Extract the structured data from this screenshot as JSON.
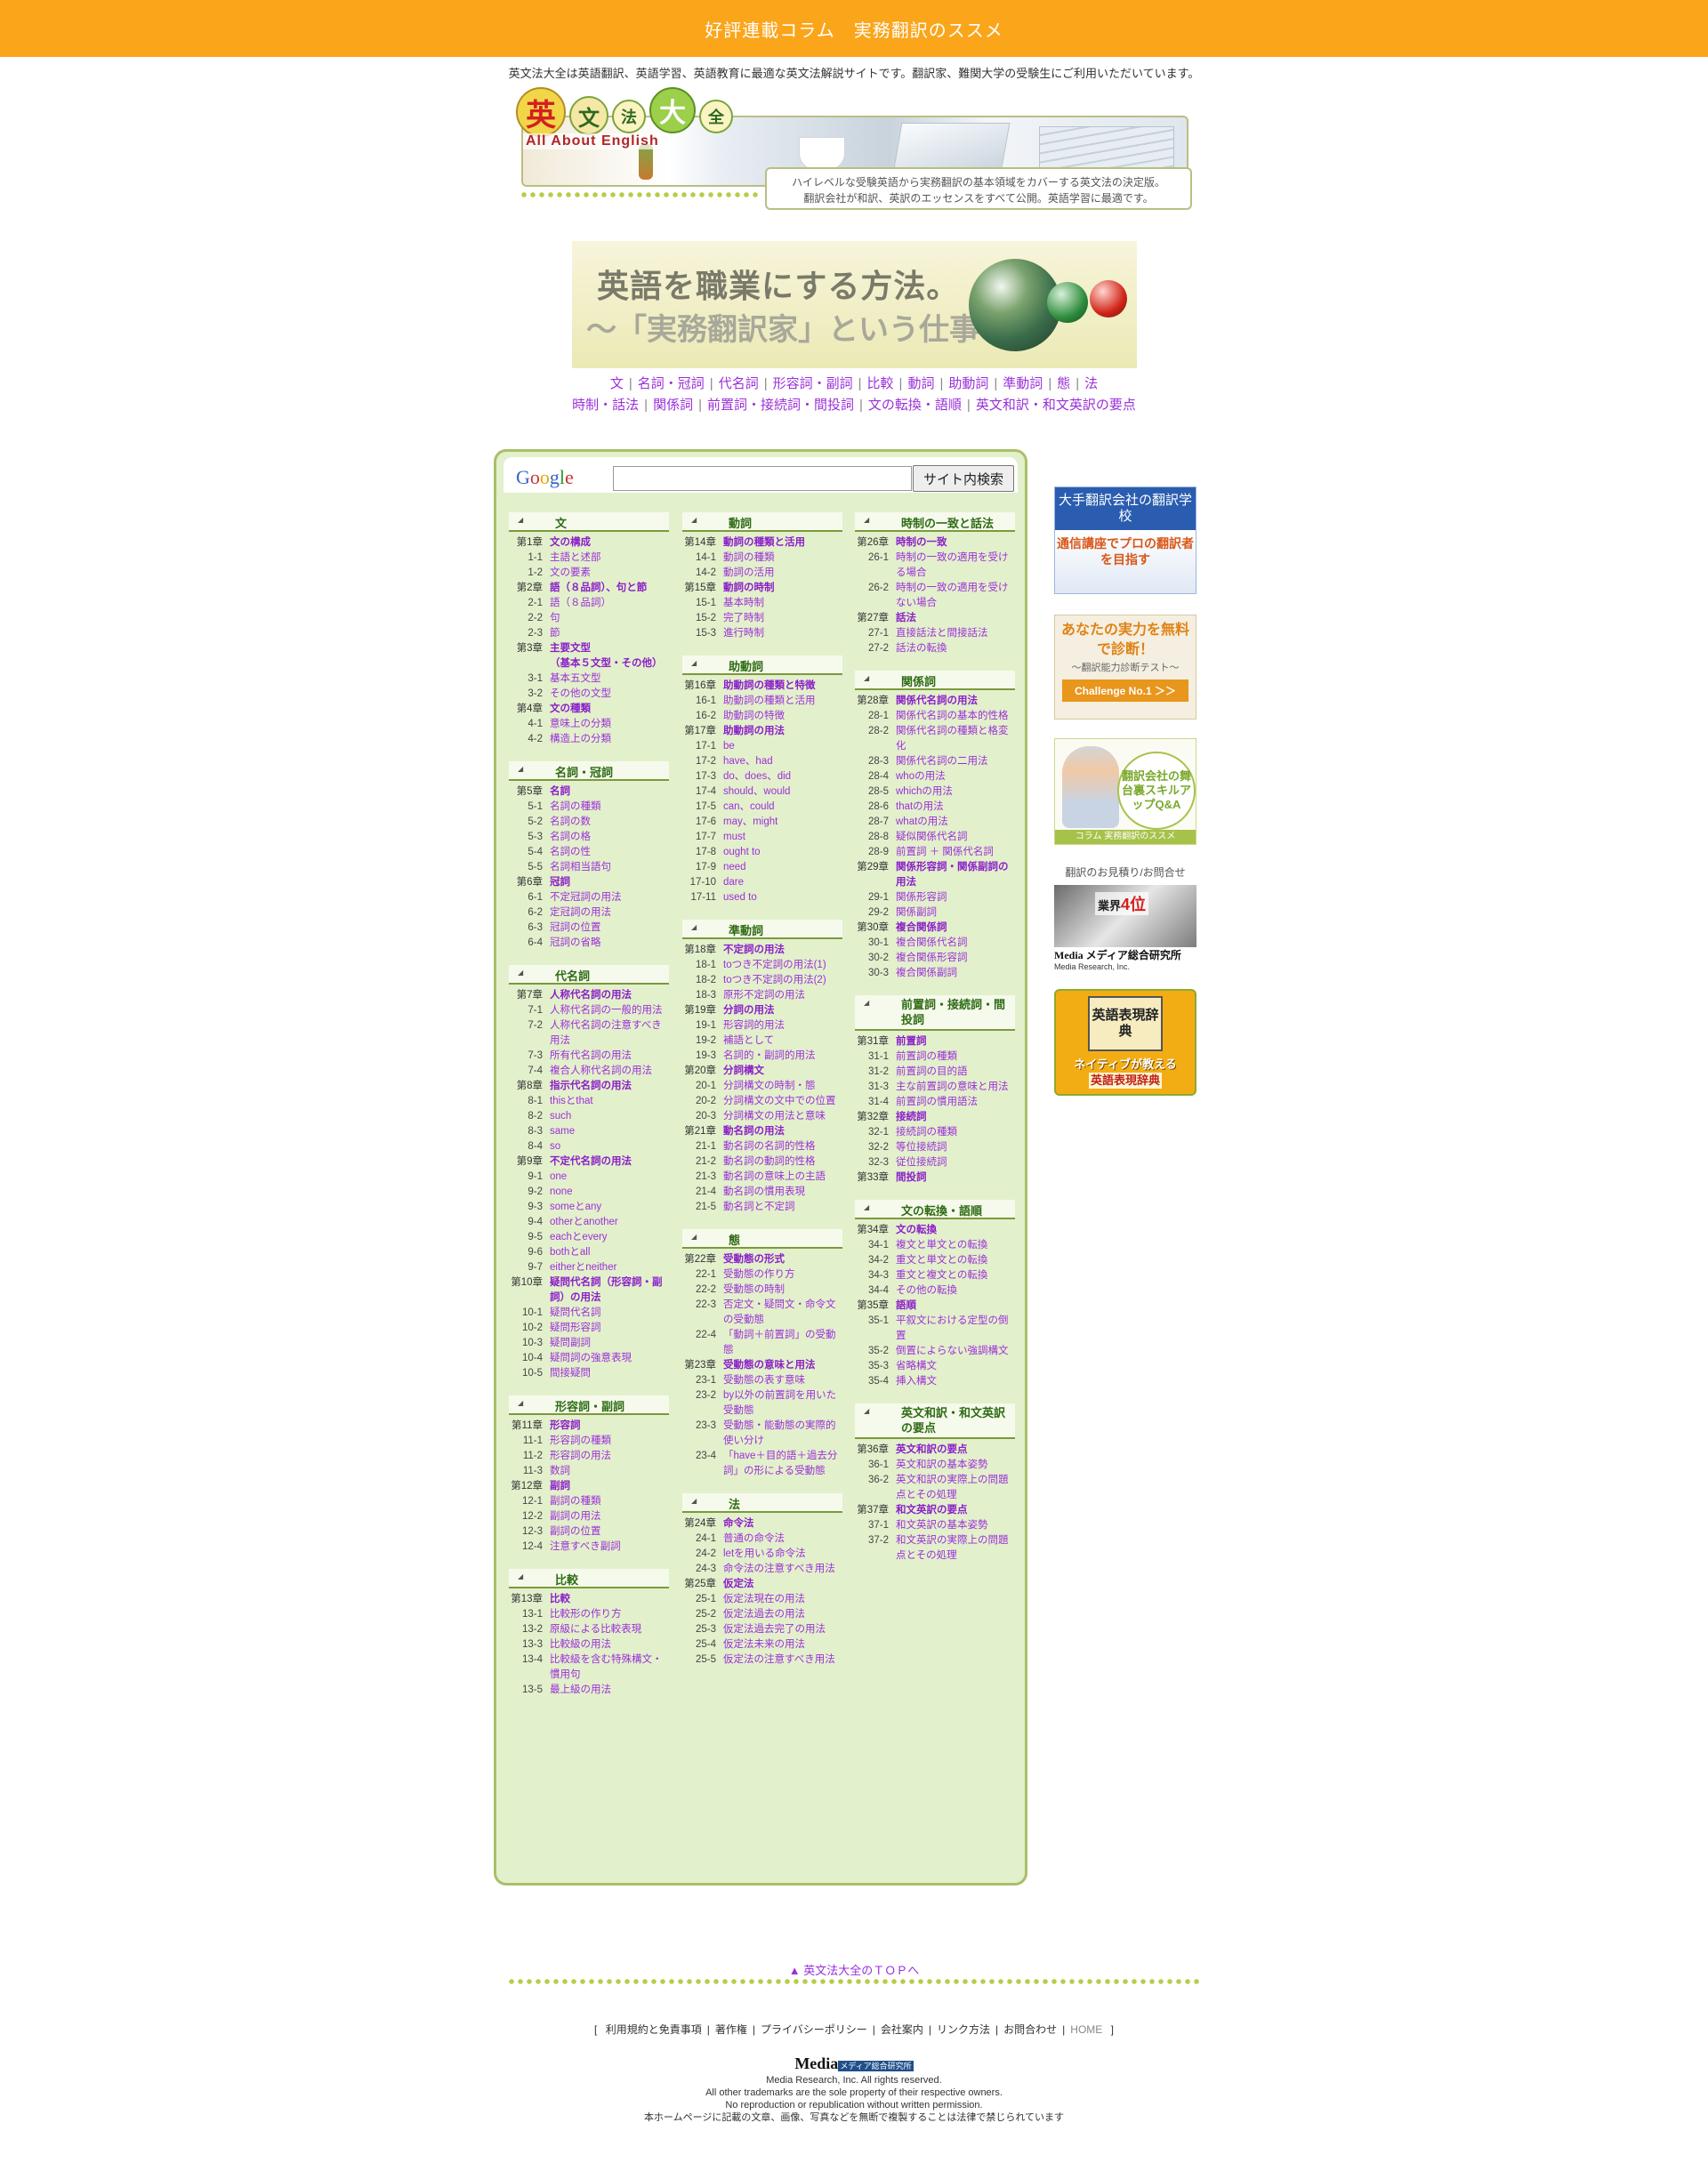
{
  "topbar": {
    "title": "好評連載コラム　実務翻訳のススメ"
  },
  "intro": "英文法大全は英語翻訳、英語学習、英語教育に最適な英文法解説サイトです。翻訳家、難関大学の受験生にご利用いただいています。",
  "header": {
    "logo_chars": [
      "英",
      "文",
      "法",
      "大",
      "全"
    ],
    "logo_sub": "All About English",
    "tagline_1": "ハイレベルな受験英語から実務翻訳の基本領域をカバーする英文法の決定版。",
    "tagline_2": "翻訳会社が和訳、英訳のエッセンスをすべて公開。英語学習に最適です。"
  },
  "promo": {
    "line1": "英語を職業にする方法。",
    "line2": "〜「実務翻訳家」という仕事〜"
  },
  "nav": {
    "row1": [
      "文",
      "名詞・冠詞",
      "代名詞",
      "形容詞・副詞",
      "比較",
      "動詞",
      "助動詞",
      "準動詞",
      "態",
      "法"
    ],
    "row2": [
      "時制・話法",
      "関係詞",
      "前置詞・接続詞・間投詞",
      "文の転換・語順",
      "英文和訳・和文英訳の要点"
    ]
  },
  "search": {
    "logo": "Google",
    "button": "サイト内検索",
    "value": ""
  },
  "columns": [
    [
      {
        "title": "文",
        "rows": [
          [
            "第1章",
            "文の構成",
            1
          ],
          [
            "1-1",
            "主語と述部",
            0
          ],
          [
            "1-2",
            "文の要素",
            0
          ],
          [
            "第2章",
            "語（８品詞）、句と節",
            1
          ],
          [
            "2-1",
            "語（８品詞）",
            0
          ],
          [
            "2-2",
            "句",
            0
          ],
          [
            "2-3",
            "節",
            0
          ],
          [
            "第3章",
            "主要文型\n（基本５文型・その他）",
            1
          ],
          [
            "3-1",
            "基本五文型",
            0
          ],
          [
            "3-2",
            "その他の文型",
            0
          ],
          [
            "第4章",
            "文の種類",
            1
          ],
          [
            "4-1",
            "意味上の分類",
            0
          ],
          [
            "4-2",
            "構造上の分類",
            0
          ]
        ]
      },
      {
        "title": "名詞・冠詞",
        "rows": [
          [
            "第5章",
            "名詞",
            1
          ],
          [
            "5-1",
            "名詞の種類",
            0
          ],
          [
            "5-2",
            "名詞の数",
            0
          ],
          [
            "5-3",
            "名詞の格",
            0
          ],
          [
            "5-4",
            "名詞の性",
            0
          ],
          [
            "5-5",
            "名詞相当語句",
            0
          ],
          [
            "第6章",
            "冠詞",
            1
          ],
          [
            "6-1",
            "不定冠詞の用法",
            0
          ],
          [
            "6-2",
            "定冠詞の用法",
            0
          ],
          [
            "6-3",
            "冠詞の位置",
            0
          ],
          [
            "6-4",
            "冠詞の省略",
            0
          ]
        ]
      },
      {
        "title": "代名詞",
        "rows": [
          [
            "第7章",
            "人称代名詞の用法",
            1
          ],
          [
            "7-1",
            "人称代名詞の一般的用法",
            0
          ],
          [
            "7-2",
            "人称代名詞の注意すべき用法",
            0
          ],
          [
            "7-3",
            "所有代名詞の用法",
            0
          ],
          [
            "7-4",
            "複合人称代名詞の用法",
            0
          ],
          [
            "第8章",
            "指示代名詞の用法",
            1
          ],
          [
            "8-1",
            "thisとthat",
            0
          ],
          [
            "8-2",
            "such",
            0
          ],
          [
            "8-3",
            "same",
            0
          ],
          [
            "8-4",
            "so",
            0
          ],
          [
            "第9章",
            "不定代名詞の用法",
            1
          ],
          [
            "9-1",
            "one",
            0
          ],
          [
            "9-2",
            "none",
            0
          ],
          [
            "9-3",
            "someとany",
            0
          ],
          [
            "9-4",
            "otherとanother",
            0
          ],
          [
            "9-5",
            "eachとevery",
            0
          ],
          [
            "9-6",
            "bothとall",
            0
          ],
          [
            "9-7",
            "eitherとneither",
            0
          ],
          [
            "第10章",
            "疑問代名詞（形容詞・副詞）の用法",
            1
          ],
          [
            "10-1",
            "疑問代名詞",
            0
          ],
          [
            "10-2",
            "疑問形容詞",
            0
          ],
          [
            "10-3",
            "疑問副詞",
            0
          ],
          [
            "10-4",
            "疑問詞の強意表現",
            0
          ],
          [
            "10-5",
            "間接疑問",
            0
          ]
        ]
      },
      {
        "title": "形容詞・副詞",
        "rows": [
          [
            "第11章",
            "形容詞",
            1
          ],
          [
            "11-1",
            "形容詞の種類",
            0
          ],
          [
            "11-2",
            "形容詞の用法",
            0
          ],
          [
            "11-3",
            "数詞",
            0
          ],
          [
            "第12章",
            "副詞",
            1
          ],
          [
            "12-1",
            "副詞の種類",
            0
          ],
          [
            "12-2",
            "副詞の用法",
            0
          ],
          [
            "12-3",
            "副詞の位置",
            0
          ],
          [
            "12-4",
            "注意すべき副詞",
            0
          ]
        ]
      },
      {
        "title": "比較",
        "rows": [
          [
            "第13章",
            "比較",
            1
          ],
          [
            "13-1",
            "比較形の作り方",
            0
          ],
          [
            "13-2",
            "原級による比較表現",
            0
          ],
          [
            "13-3",
            "比較級の用法",
            0
          ],
          [
            "13-4",
            "比較級を含む特殊構文・慣用句",
            0
          ],
          [
            "13-5",
            "最上級の用法",
            0
          ]
        ]
      }
    ],
    [
      {
        "title": "動詞",
        "rows": [
          [
            "第14章",
            "動詞の種類と活用",
            1
          ],
          [
            "14-1",
            "動詞の種類",
            0
          ],
          [
            "14-2",
            "動詞の活用",
            0
          ],
          [
            "第15章",
            "動詞の時制",
            1
          ],
          [
            "15-1",
            "基本時制",
            0
          ],
          [
            "15-2",
            "完了時制",
            0
          ],
          [
            "15-3",
            "進行時制",
            0
          ]
        ]
      },
      {
        "title": "助動詞",
        "rows": [
          [
            "第16章",
            "助動詞の種類と特徴",
            1
          ],
          [
            "16-1",
            "助動詞の種類と活用",
            0
          ],
          [
            "16-2",
            "助動詞の特徴",
            0
          ],
          [
            "第17章",
            "助動詞の用法",
            1
          ],
          [
            "17-1",
            "be",
            0
          ],
          [
            "17-2",
            "have、had",
            0
          ],
          [
            "17-3",
            "do、does、did",
            0
          ],
          [
            "17-4",
            "should、would",
            0
          ],
          [
            "17-5",
            "can、could",
            0
          ],
          [
            "17-6",
            "may、might",
            0
          ],
          [
            "17-7",
            "must",
            0
          ],
          [
            "17-8",
            "ought to",
            0
          ],
          [
            "17-9",
            "need",
            0
          ],
          [
            "17-10",
            "dare",
            0
          ],
          [
            "17-11",
            "used to",
            0
          ]
        ]
      },
      {
        "title": "準動詞",
        "rows": [
          [
            "第18章",
            "不定詞の用法",
            1
          ],
          [
            "18-1",
            "toつき不定詞の用法(1)",
            0
          ],
          [
            "18-2",
            "toつき不定詞の用法(2)",
            0
          ],
          [
            "18-3",
            "原形不定詞の用法",
            0
          ],
          [
            "第19章",
            "分詞の用法",
            1
          ],
          [
            "19-1",
            "形容詞的用法",
            0
          ],
          [
            "19-2",
            "補語として",
            0
          ],
          [
            "19-3",
            "名詞的・副詞的用法",
            0
          ],
          [
            "第20章",
            "分詞構文",
            1
          ],
          [
            "20-1",
            "分詞構文の時制・態",
            0
          ],
          [
            "20-2",
            "分詞構文の文中での位置",
            0
          ],
          [
            "20-3",
            "分詞構文の用法と意味",
            0
          ],
          [
            "第21章",
            "動名詞の用法",
            1
          ],
          [
            "21-1",
            "動名詞の名詞的性格",
            0
          ],
          [
            "21-2",
            "動名詞の動詞的性格",
            0
          ],
          [
            "21-3",
            "動名詞の意味上の主語",
            0
          ],
          [
            "21-4",
            "動名詞の慣用表現",
            0
          ],
          [
            "21-5",
            "動名詞と不定詞",
            0
          ]
        ]
      },
      {
        "title": "態",
        "rows": [
          [
            "第22章",
            "受動態の形式",
            1
          ],
          [
            "22-1",
            "受動態の作り方",
            0
          ],
          [
            "22-2",
            "受動態の時制",
            0
          ],
          [
            "22-3",
            "否定文・疑問文・命令文の受動態",
            0
          ],
          [
            "22-4",
            "「動詞＋前置詞」の受動態",
            0
          ],
          [
            "第23章",
            "受動態の意味と用法",
            1
          ],
          [
            "23-1",
            "受動態の表す意味",
            0
          ],
          [
            "23-2",
            "by以外の前置詞を用いた受動態",
            0
          ],
          [
            "23-3",
            "受動態・能動態の実際的使い分け",
            0
          ],
          [
            "23-4",
            "「have＋目的語＋過去分詞」の形による受動態",
            0
          ]
        ]
      },
      {
        "title": "法",
        "rows": [
          [
            "第24章",
            "命令法",
            1
          ],
          [
            "24-1",
            "普通の命令法",
            0
          ],
          [
            "24-2",
            "letを用いる命令法",
            0
          ],
          [
            "24-3",
            "命令法の注意すべき用法",
            0
          ],
          [
            "第25章",
            "仮定法",
            1
          ],
          [
            "25-1",
            "仮定法現在の用法",
            0
          ],
          [
            "25-2",
            "仮定法過去の用法",
            0
          ],
          [
            "25-3",
            "仮定法過去完了の用法",
            0
          ],
          [
            "25-4",
            "仮定法未来の用法",
            0
          ],
          [
            "25-5",
            "仮定法の注意すべき用法",
            0
          ]
        ]
      }
    ],
    [
      {
        "title": "時制の一致と話法",
        "rows": [
          [
            "第26章",
            "時制の一致",
            1
          ],
          [
            "26-1",
            "時制の一致の適用を受ける場合",
            0
          ],
          [
            "26-2",
            "時制の一致の適用を受けない場合",
            0
          ],
          [
            "第27章",
            "話法",
            1
          ],
          [
            "27-1",
            "直接話法と間接話法",
            0
          ],
          [
            "27-2",
            "話法の転換",
            0
          ]
        ]
      },
      {
        "title": "関係詞",
        "rows": [
          [
            "第28章",
            "関係代名詞の用法",
            1
          ],
          [
            "28-1",
            "関係代名詞の基本的性格",
            0
          ],
          [
            "28-2",
            "関係代名詞の種類と格変化",
            0
          ],
          [
            "28-3",
            "関係代名詞の二用法",
            0
          ],
          [
            "28-4",
            "whoの用法",
            0
          ],
          [
            "28-5",
            "whichの用法",
            0
          ],
          [
            "28-6",
            "thatの用法",
            0
          ],
          [
            "28-7",
            "whatの用法",
            0
          ],
          [
            "28-8",
            "疑似関係代名詞",
            0
          ],
          [
            "28-9",
            "前置詞 ＋ 関係代名詞",
            0
          ],
          [
            "第29章",
            "関係形容詞・関係副詞の用法",
            1
          ],
          [
            "29-1",
            "関係形容詞",
            0
          ],
          [
            "29-2",
            "関係副詞",
            0
          ],
          [
            "第30章",
            "複合関係詞",
            1
          ],
          [
            "30-1",
            "複合関係代名詞",
            0
          ],
          [
            "30-2",
            "複合関係形容詞",
            0
          ],
          [
            "30-3",
            "複合関係副詞",
            0
          ]
        ]
      },
      {
        "title": "前置詞・接続詞・間投詞",
        "rows": [
          [
            "第31章",
            "前置詞",
            1
          ],
          [
            "31-1",
            "前置詞の種類",
            0
          ],
          [
            "31-2",
            "前置詞の目的語",
            0
          ],
          [
            "31-3",
            "主な前置詞の意味と用法",
            0
          ],
          [
            "31-4",
            "前置詞の慣用語法",
            0
          ],
          [
            "第32章",
            "接続詞",
            1
          ],
          [
            "32-1",
            "接続詞の種類",
            0
          ],
          [
            "32-2",
            "等位接続詞",
            0
          ],
          [
            "32-3",
            "従位接続詞",
            0
          ],
          [
            "第33章",
            "間投詞",
            1
          ]
        ]
      },
      {
        "title": "文の転換・語順",
        "rows": [
          [
            "第34章",
            "文の転換",
            1
          ],
          [
            "34-1",
            "複文と単文との転換",
            0
          ],
          [
            "34-2",
            "重文と単文との転換",
            0
          ],
          [
            "34-3",
            "重文と複文との転換",
            0
          ],
          [
            "34-4",
            "その他の転換",
            0
          ],
          [
            "第35章",
            "語順",
            1
          ],
          [
            "35-1",
            "平叙文における定型の倒置",
            0
          ],
          [
            "35-2",
            "倒置によらない強調構文",
            0
          ],
          [
            "35-3",
            "省略構文",
            0
          ],
          [
            "35-4",
            "挿入構文",
            0
          ]
        ]
      },
      {
        "title": "英文和訳・和文英訳の要点",
        "rows": [
          [
            "第36章",
            "英文和訳の要点",
            1
          ],
          [
            "36-1",
            "英文和訳の基本姿勢",
            0
          ],
          [
            "36-2",
            "英文和訳の実際上の問題点とその処理",
            0
          ],
          [
            "第37章",
            "和文英訳の要点",
            1
          ],
          [
            "37-1",
            "和文英訳の基本姿勢",
            0
          ],
          [
            "37-2",
            "和文英訳の実際上の問題点とその処理",
            0
          ]
        ]
      }
    ]
  ],
  "sidebar": {
    "ad1": {
      "head": "大手翻訳会社の翻訳学校",
      "body": "通信講座でプロの翻訳者を目指す"
    },
    "ad2": {
      "head": "あなたの実力を無料で診断！",
      "sub": "〜翻訳能力診断テスト〜",
      "button": "Challenge No.1 ＞＞"
    },
    "ad3": {
      "circle": "翻訳会社の舞台裏スキルアップQ&A",
      "foot": "コラム 実務翻訳のススメ"
    },
    "ad4": {
      "caption": "翻訳のお見積り/お問合せ",
      "rank": "業界",
      "rank_num": "4位",
      "company": "Media メディア総合研究所",
      "company_en": "Media Research, Inc."
    },
    "ad5": {
      "book": "英語表現辞典",
      "line1": "ネイティブが教える",
      "line2": "英語表現辞典"
    }
  },
  "footer": {
    "top_link": "▲ 英文法大全のＴＯＰへ",
    "links": [
      "利用規約と免責事項",
      "著作権",
      "プライバシーポリシー",
      "会社案内",
      "リンク方法",
      "お問合わせ"
    ],
    "home": "HOME",
    "logo": "Media",
    "logo_jp": "メディア総合研究所",
    "copy": [
      "Media Research, Inc. All rights reserved.",
      "All other trademarks are the sole property of their respective owners.",
      "No reproduction or republication without written permission.",
      "本ホームページに記載の文章、画像、写真などを無断で複製することは法律で禁じられています"
    ]
  },
  "colors": {
    "topbar": "#fba51b",
    "panel": "#e3f0cc",
    "border": "#a9bf6a",
    "link": "#9b30d9",
    "heading": "#2e6b14"
  }
}
